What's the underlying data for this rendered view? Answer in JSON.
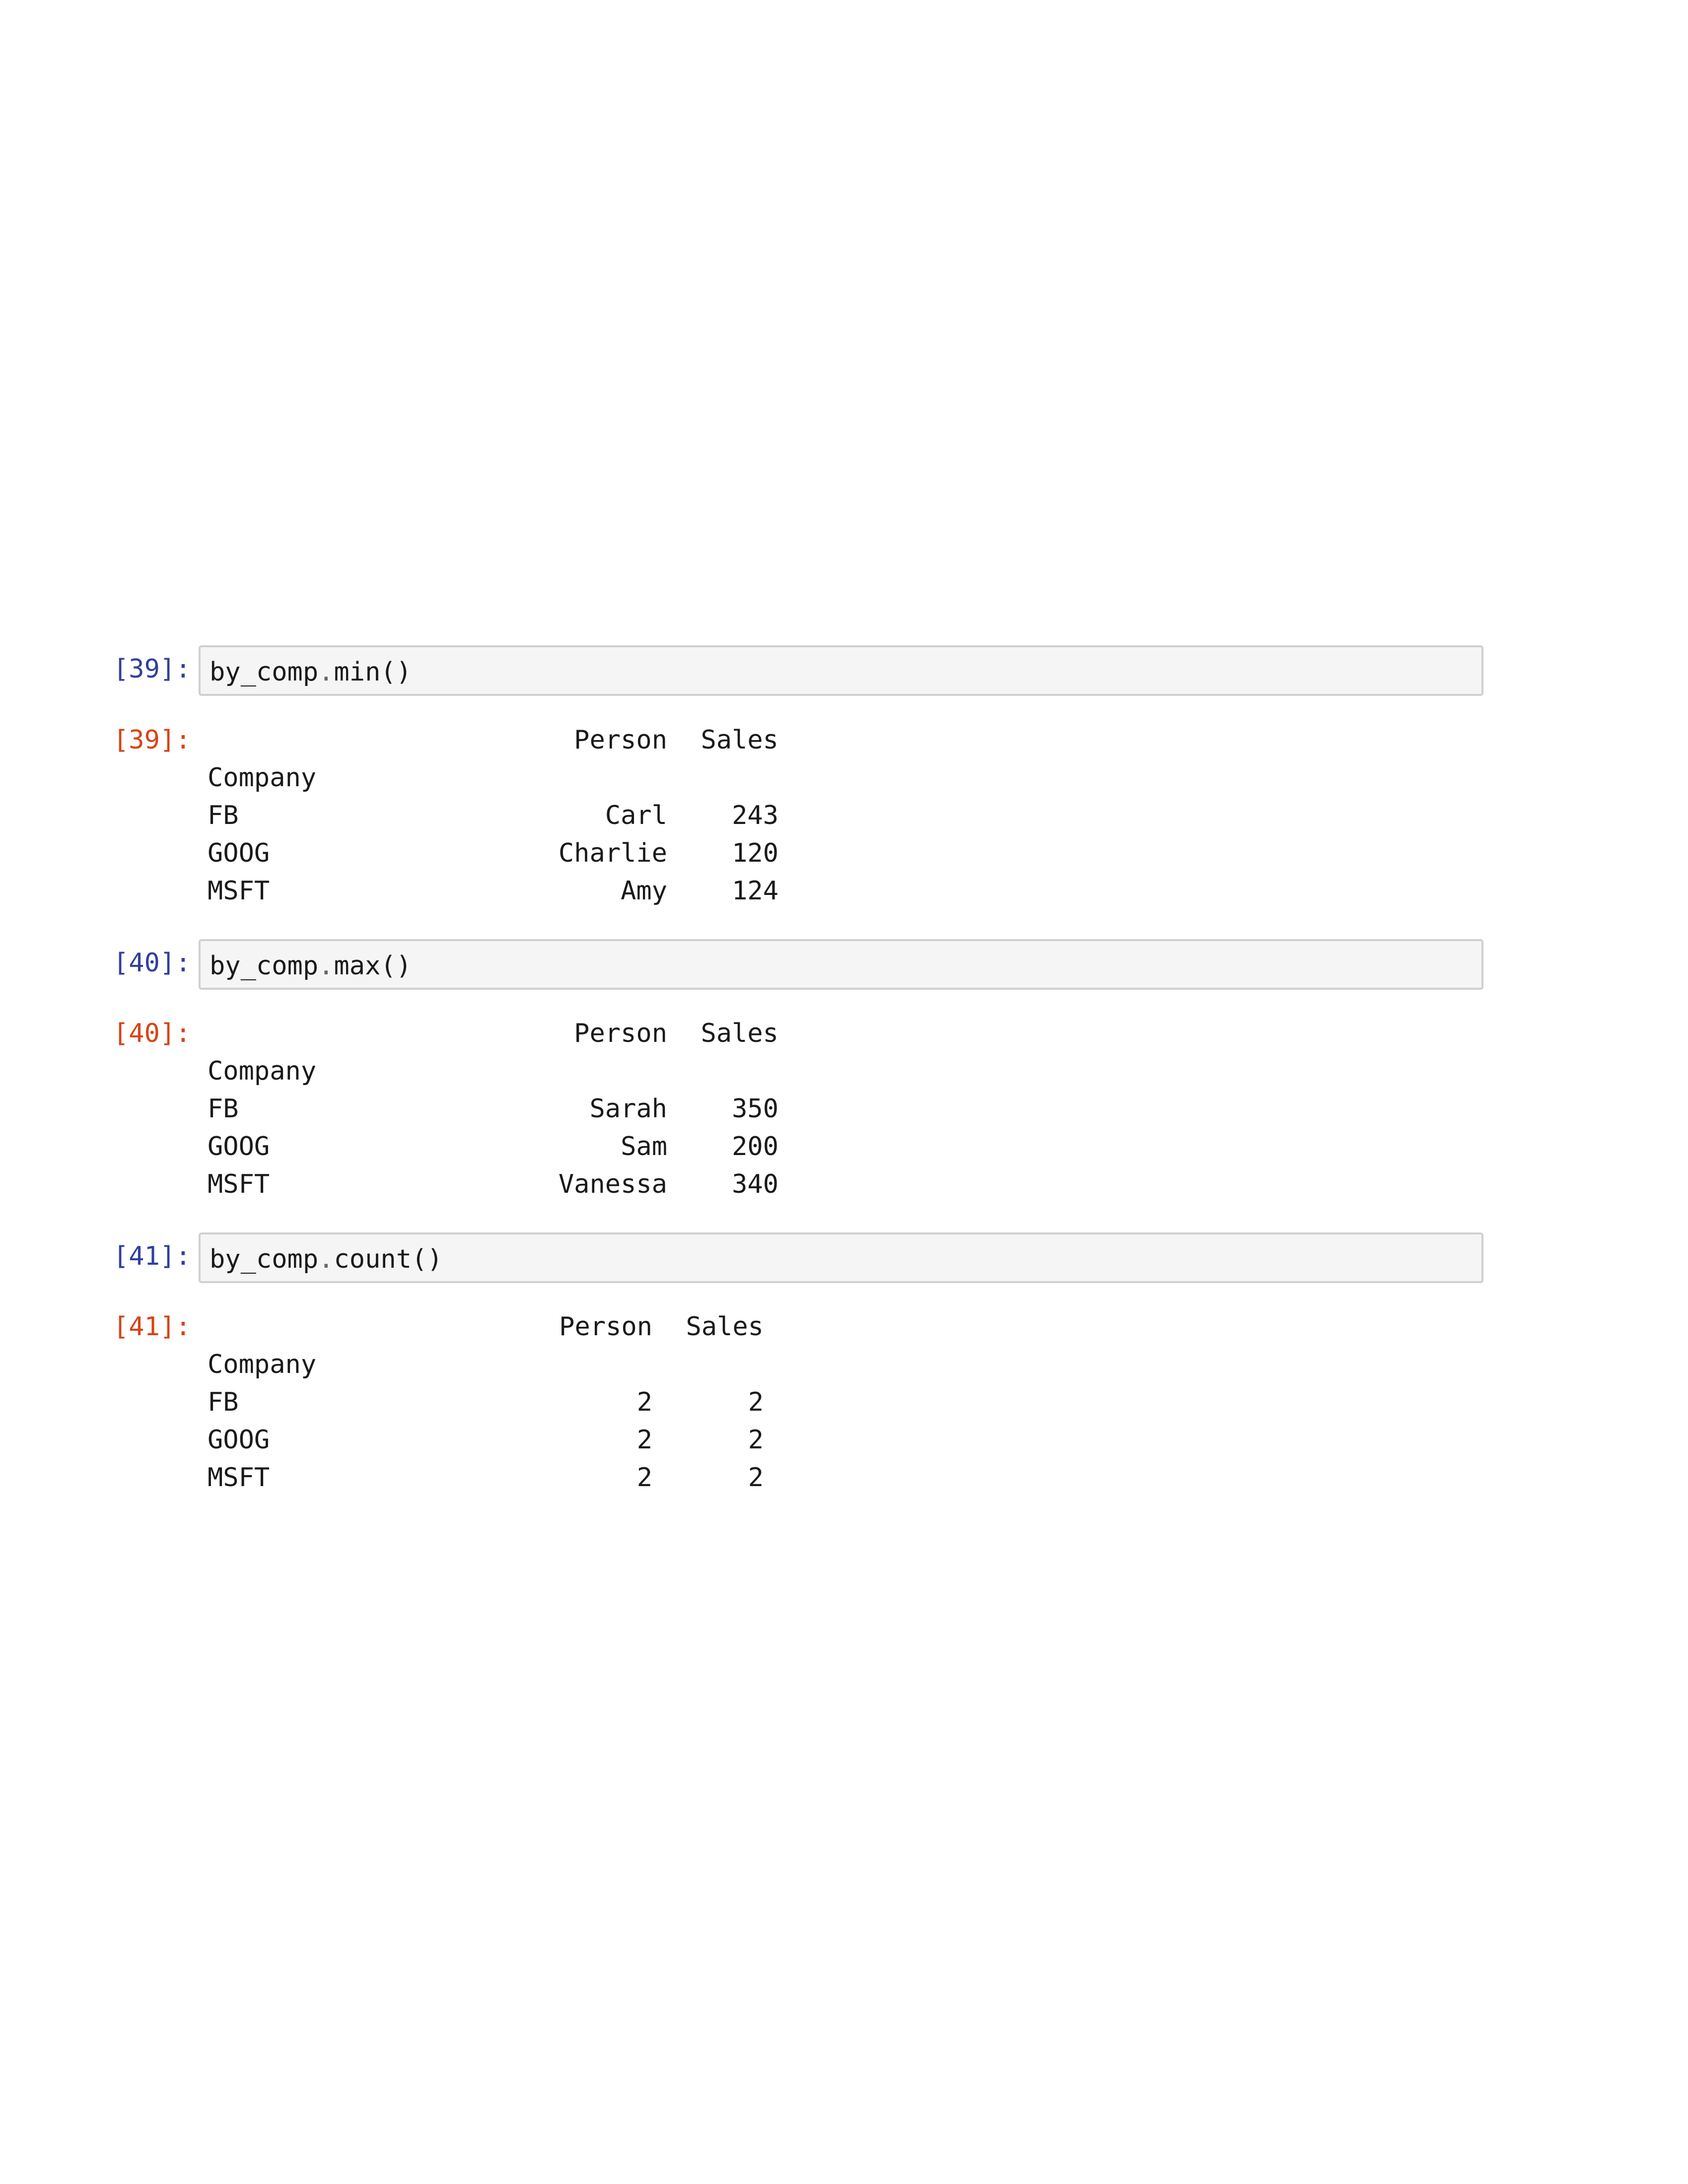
{
  "cells": [
    {
      "in_prompt": "[39]:",
      "code": {
        "obj": "by_comp",
        "method": "min()"
      },
      "out_prompt": "[39]:",
      "output": {
        "columns": [
          "Person",
          "Sales"
        ],
        "index_name": "Company",
        "rows": [
          {
            "index": "FB",
            "values": [
              "Carl",
              "243"
            ]
          },
          {
            "index": "GOOG",
            "values": [
              "Charlie",
              "120"
            ]
          },
          {
            "index": "MSFT",
            "values": [
              "Amy",
              "124"
            ]
          }
        ]
      }
    },
    {
      "in_prompt": "[40]:",
      "code": {
        "obj": "by_comp",
        "method": "max()"
      },
      "out_prompt": "[40]:",
      "output": {
        "columns": [
          "Person",
          "Sales"
        ],
        "index_name": "Company",
        "rows": [
          {
            "index": "FB",
            "values": [
              "Sarah",
              "350"
            ]
          },
          {
            "index": "GOOG",
            "values": [
              "Sam",
              "200"
            ]
          },
          {
            "index": "MSFT",
            "values": [
              "Vanessa",
              "340"
            ]
          }
        ]
      }
    },
    {
      "in_prompt": "[41]:",
      "code": {
        "obj": "by_comp",
        "method": "count()"
      },
      "out_prompt": "[41]:",
      "output": {
        "columns": [
          "Person",
          "Sales"
        ],
        "index_name": "Company",
        "rows": [
          {
            "index": "FB",
            "values": [
              "2",
              "2"
            ]
          },
          {
            "index": "GOOG",
            "values": [
              "2",
              "2"
            ]
          },
          {
            "index": "MSFT",
            "values": [
              "2",
              "2"
            ]
          }
        ]
      }
    }
  ]
}
